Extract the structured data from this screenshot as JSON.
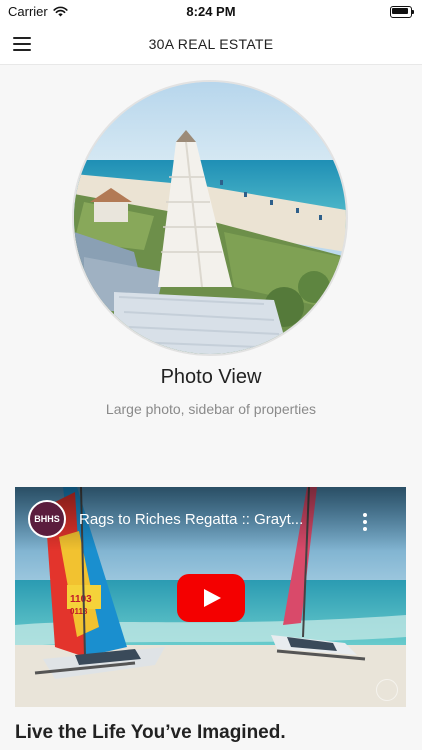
{
  "status_bar": {
    "carrier": "Carrier",
    "time": "8:24 PM",
    "wifi_icon": "wifi-icon",
    "battery_icon": "battery-icon"
  },
  "nav": {
    "title": "30A REAL ESTATE",
    "menu_icon": "hamburger-menu-icon"
  },
  "layout_option": {
    "title": "Photo View",
    "subtitle": "Large photo, sidebar of properties",
    "image": "beach-tower-photo"
  },
  "video": {
    "channel_logo": "BHHS",
    "title": "Rags to Riches Regatta :: Grayt...",
    "play_icon": "play-icon",
    "more_icon": "more-vertical-icon",
    "sail_number": "1103",
    "sail_text": "0118"
  },
  "section": {
    "heading": "Live the Life You’ve Imagined."
  },
  "colors": {
    "youtube_red": "#f40000",
    "channel_logo_bg": "#5b1d3d",
    "subtitle_gray": "#8a8a8a"
  }
}
